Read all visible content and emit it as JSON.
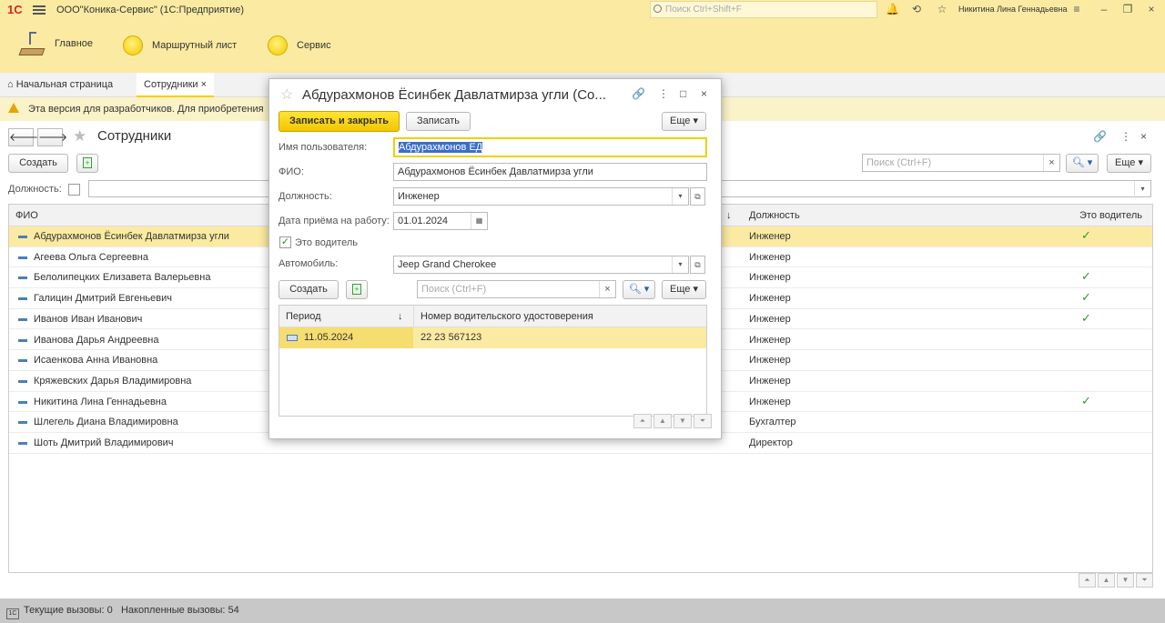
{
  "app": {
    "logo": "1С",
    "title": "ООО\"Коника-Сервис\"  (1С:Предприятие)",
    "search_placeholder": "Поиск Ctrl+Shift+F",
    "user": "Никитина Лина Геннадьевна"
  },
  "sections": [
    "Главное",
    "Маршрутный лист",
    "Сервис"
  ],
  "tabs": {
    "home": "Начальная страница",
    "employees": "Сотрудники",
    "close": "×"
  },
  "warning": "Эта версия для разработчиков. Для приобретения",
  "list": {
    "title": "Сотрудники",
    "create_label": "Создать",
    "search_placeholder": "Поиск (Ctrl+F)",
    "more_label": "Еще",
    "filter_label": "Должность:",
    "columns": {
      "fio": "ФИО",
      "position": "Должность",
      "driver": "Это водитель",
      "sort": "↓"
    },
    "rows": [
      {
        "fio": "Абдурахмонов Ёсинбек Давлатмирза угли",
        "position": "Инженер",
        "driver": "✓"
      },
      {
        "fio": "Агеева Ольга Сергеевна",
        "position": "Инженер",
        "driver": ""
      },
      {
        "fio": "Белолипецких Елизавета Валерьевна",
        "position": "Инженер",
        "driver": "✓"
      },
      {
        "fio": "Галицин Дмитрий Евгеньевич",
        "position": "Инженер",
        "driver": "✓"
      },
      {
        "fio": "Иванов Иван Иванович",
        "position": "Инженер",
        "driver": "✓"
      },
      {
        "fio": "Иванова Дарья Андреевна",
        "position": "Инженер",
        "driver": ""
      },
      {
        "fio": "Исаенкова Анна Ивановна",
        "position": "Инженер",
        "driver": ""
      },
      {
        "fio": "Кряжевских Дарья Владимировна",
        "position": "Инженер",
        "driver": ""
      },
      {
        "fio": "Никитина Лина Геннадьевна",
        "position": "Инженер",
        "driver": "✓"
      },
      {
        "fio": "Шлегель Диана Владимировна",
        "position": "Бухгалтер",
        "driver": ""
      },
      {
        "fio": "Шоть Дмитрий Владимирович",
        "position": "Директор",
        "driver": ""
      }
    ]
  },
  "dialog": {
    "title": "Абдурахмонов Ёсинбек Давлатмирза угли (Со...",
    "save_close_label": "Записать и закрыть",
    "save_label": "Записать",
    "more_label": "Еще",
    "username_label": "Имя пользователя:",
    "username_value": "Абдурахмонов ЕД",
    "fio_label": "ФИО:",
    "fio_value": "Абдурахмонов Ёсинбек Давлатмирза угли",
    "position_label": "Должность:",
    "position_value": "Инженер",
    "hire_date_label": "Дата приёма на работу:",
    "hire_date_value": "01.01.2024",
    "is_driver_label": "Это водитель",
    "is_driver_checked": true,
    "car_label": "Автомобиль:",
    "car_value": "Jeep Grand Cherokee",
    "create_label": "Создать",
    "search_placeholder": "Поиск (Ctrl+F)",
    "table": {
      "col_period": "Период",
      "col_license": "Номер водительского удостоверения",
      "sort": "↓",
      "rows": [
        {
          "period": "11.05.2024",
          "license": "22 23 567123"
        }
      ]
    }
  },
  "status": {
    "current_calls": "Текущие вызовы: 0",
    "accumulated_calls": "Накопленные вызовы: 54"
  },
  "colors": {
    "accent_yellow": "#fbeba2",
    "button_yellow": "#f5d000",
    "check_green": "#2e9a2e"
  }
}
